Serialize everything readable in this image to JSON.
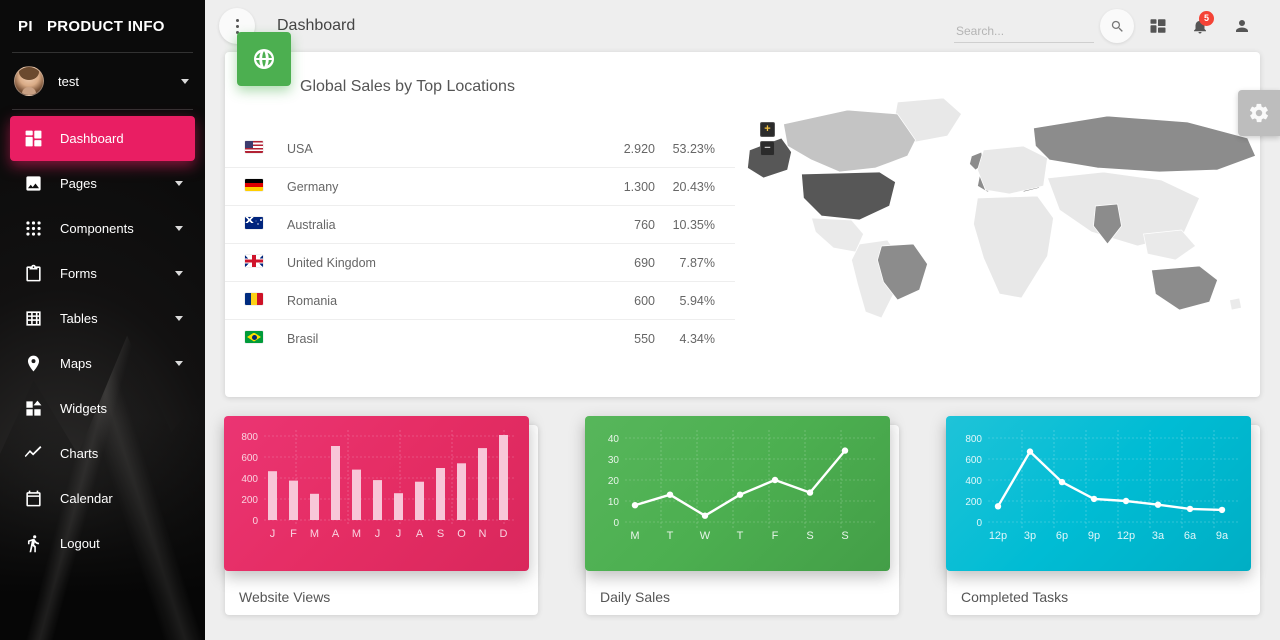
{
  "sidebar": {
    "brand_mark": "PI",
    "brand_name": "PRODUCT INFO",
    "user": {
      "name": "test"
    },
    "items": [
      {
        "label": "Dashboard",
        "icon": "dashboard-icon",
        "active": true,
        "caret": false
      },
      {
        "label": "Pages",
        "icon": "image-icon",
        "active": false,
        "caret": true
      },
      {
        "label": "Components",
        "icon": "apps-grid-icon",
        "active": false,
        "caret": true
      },
      {
        "label": "Forms",
        "icon": "clipboard-icon",
        "active": false,
        "caret": true
      },
      {
        "label": "Tables",
        "icon": "table-grid-icon",
        "active": false,
        "caret": true
      },
      {
        "label": "Maps",
        "icon": "map-pin-icon",
        "active": false,
        "caret": true
      },
      {
        "label": "Widgets",
        "icon": "widgets-icon",
        "active": false,
        "caret": false
      },
      {
        "label": "Charts",
        "icon": "line-chart-icon",
        "active": false,
        "caret": false
      },
      {
        "label": "Calendar",
        "icon": "calendar-icon",
        "active": false,
        "caret": false
      },
      {
        "label": "Logout",
        "icon": "run-exit-icon",
        "active": false,
        "caret": false
      }
    ]
  },
  "topbar": {
    "menu_icon": "more-vert-icon",
    "title": "Dashboard",
    "search": {
      "value": "",
      "placeholder": "Search..."
    },
    "search_icon": "search-icon",
    "dashboard_icon": "dashboard-grid-icon",
    "notifications_icon": "bell-icon",
    "notifications_count": "5",
    "profile_icon": "person-icon"
  },
  "settings_fab": {
    "icon": "gear-icon"
  },
  "sales_card": {
    "icon": "globe-icon",
    "title": "Global Sales by Top Locations",
    "rows": [
      {
        "flag": "f-usa",
        "country": "USA",
        "value": "2.920",
        "percent": "53.23%"
      },
      {
        "flag": "f-de",
        "country": "Germany",
        "value": "1.300",
        "percent": "20.43%"
      },
      {
        "flag": "f-au",
        "country": "Australia",
        "value": "760",
        "percent": "10.35%"
      },
      {
        "flag": "f-uk",
        "country": "United Kingdom",
        "value": "690",
        "percent": "7.87%"
      },
      {
        "flag": "f-ro",
        "country": "Romania",
        "value": "600",
        "percent": "5.94%"
      },
      {
        "flag": "f-br",
        "country": "Brasil",
        "value": "550",
        "percent": "4.34%"
      }
    ],
    "map": {
      "zoom_in_label": "+",
      "zoom_out_label": "−",
      "highlighted": [
        "USA",
        "Germany",
        "Australia",
        "United Kingdom",
        "Romania",
        "Brasil",
        "Canada",
        "Russia",
        "France",
        "India"
      ]
    }
  },
  "chart_data": [
    {
      "type": "bar",
      "title": "Website Views",
      "categories": [
        "J",
        "F",
        "M",
        "A",
        "M",
        "J",
        "J",
        "A",
        "S",
        "O",
        "N",
        "D"
      ],
      "values": [
        465,
        375,
        250,
        705,
        480,
        380,
        255,
        365,
        495,
        540,
        685,
        810
      ],
      "yticks": [
        "0",
        "200",
        "400",
        "600",
        "800"
      ],
      "ylim": [
        0,
        900
      ],
      "xlabel": "",
      "ylabel": "",
      "grid": true,
      "legend": "none",
      "color": "#f8c6d8",
      "background": "#e52d64"
    },
    {
      "type": "line",
      "title": "Daily Sales",
      "categories": [
        "M",
        "T",
        "W",
        "T",
        "F",
        "S",
        "S"
      ],
      "values": [
        8,
        13,
        3,
        13,
        20,
        14,
        34
      ],
      "yticks": [
        "0",
        "10",
        "20",
        "30",
        "40"
      ],
      "ylim": [
        0,
        45
      ],
      "xlabel": "",
      "ylabel": "",
      "grid": true,
      "legend": "none",
      "color": "#ffffff",
      "background": "#4caf50"
    },
    {
      "type": "line",
      "title": "Completed Tasks",
      "categories": [
        "12p",
        "3p",
        "6p",
        "9p",
        "12p",
        "3a",
        "6a",
        "9a"
      ],
      "values": [
        150,
        670,
        380,
        220,
        200,
        165,
        125,
        115
      ],
      "yticks": [
        "0",
        "200",
        "400",
        "600",
        "800"
      ],
      "ylim": [
        0,
        900
      ],
      "xlabel": "",
      "ylabel": "",
      "grid": true,
      "legend": "none",
      "color": "#ffffff",
      "background": "#00bcd4"
    }
  ],
  "colors": {
    "accent_pink": "#e91e63",
    "green": "#4caf50",
    "cyan": "#00bcd4",
    "badge_red": "#f44336",
    "page_bg": "#eeeeee"
  }
}
